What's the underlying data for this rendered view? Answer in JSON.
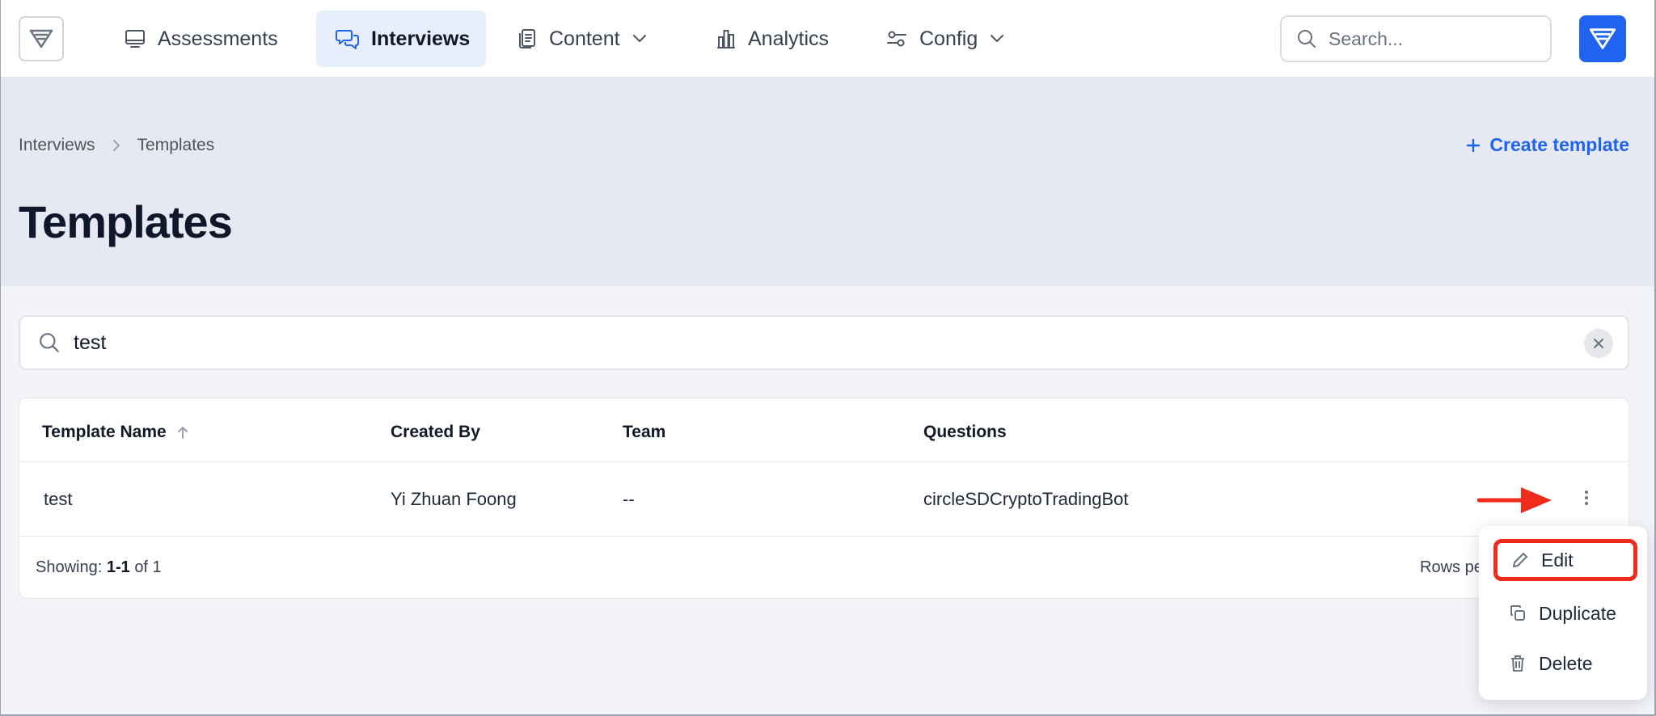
{
  "nav": {
    "items": [
      {
        "label": "Assessments",
        "icon": "monitor-icon"
      },
      {
        "label": "Interviews",
        "icon": "chat-icon",
        "active": true
      },
      {
        "label": "Content",
        "icon": "documents-icon",
        "dropdown": true
      },
      {
        "label": "Analytics",
        "icon": "bar-chart-icon"
      },
      {
        "label": "Config",
        "icon": "sliders-icon",
        "dropdown": true
      }
    ],
    "search_placeholder": "Search..."
  },
  "breadcrumb": {
    "root": "Interviews",
    "current": "Templates"
  },
  "create_button_label": "Create template",
  "page_title": "Templates",
  "filter": {
    "value": "test"
  },
  "table": {
    "columns": [
      "Template Name",
      "Created By",
      "Team",
      "Questions"
    ],
    "rows": [
      {
        "name": "test",
        "created_by": "Yi Zhuan Foong",
        "team": "--",
        "questions": "circleSDCryptoTradingBot"
      }
    ],
    "footer": {
      "showing_label": "Showing:",
      "range": "1-1",
      "of_label": "of 1",
      "rows_per_page": "Rows pe"
    }
  },
  "row_menu": {
    "items": [
      {
        "label": "Edit",
        "icon": "pencil-icon"
      },
      {
        "label": "Duplicate",
        "icon": "copy-icon"
      },
      {
        "label": "Delete",
        "icon": "trash-icon"
      }
    ]
  },
  "colors": {
    "brand": "#1f63f0",
    "annotation": "#ef2b1c",
    "nav_active_bg": "#e8eefb"
  }
}
